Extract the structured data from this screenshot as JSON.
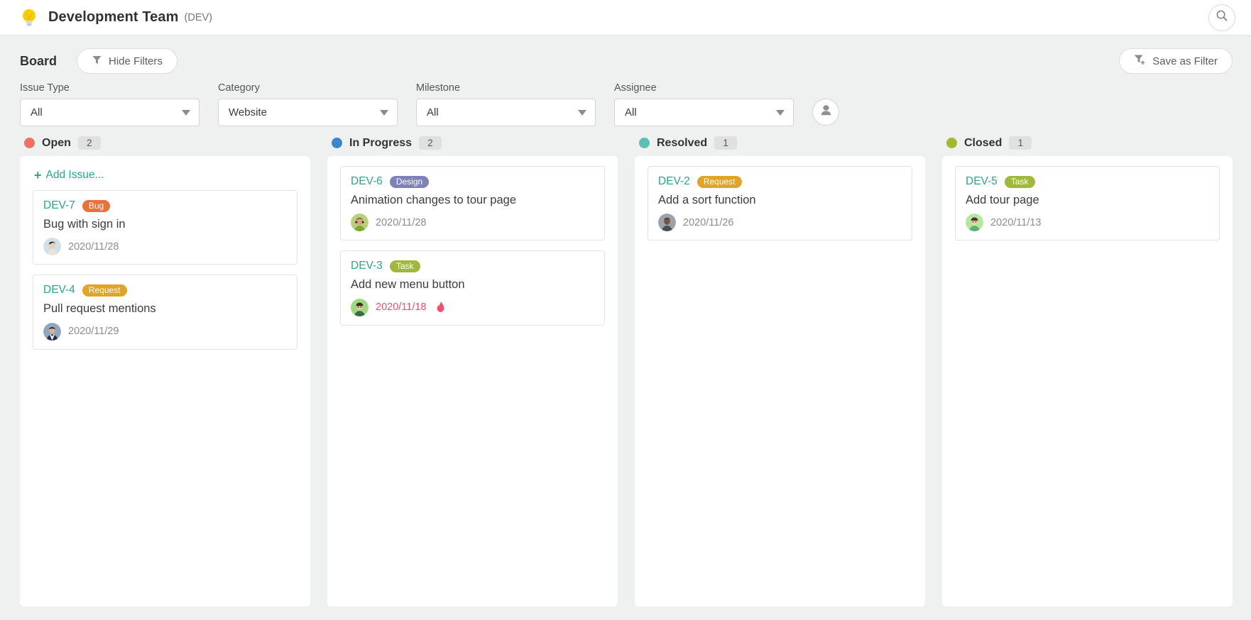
{
  "header": {
    "project_icon": "lightbulb-icon",
    "project_name": "Development Team",
    "project_key": "(DEV)",
    "search_icon": "search-icon"
  },
  "filters": {
    "board_label": "Board",
    "hide_filters_label": "Hide Filters",
    "hide_filters_icon": "funnel-icon",
    "save_as_filter_label": "Save as Filter",
    "save_as_filter_icon": "funnel-plus-icon",
    "assignee_quick_icon": "person-icon",
    "fields": [
      {
        "label": "Issue Type",
        "value": "All"
      },
      {
        "label": "Category",
        "value": "Website"
      },
      {
        "label": "Milestone",
        "value": "All"
      },
      {
        "label": "Assignee",
        "value": "All"
      }
    ]
  },
  "board": {
    "add_issue_label": "Add Issue...",
    "columns": [
      {
        "name": "Open",
        "count": "2",
        "color": "#ec7263",
        "show_add_issue": true,
        "cards": [
          {
            "key": "DEV-7",
            "badge": "Bug",
            "badge_color": "#ea7138",
            "title": "Bug with sign in",
            "date": "2020/11/28",
            "overdue": false,
            "avatar": "avatar-woman-dark-hair",
            "avatar_bg": "#cfe0e8",
            "avatar_fg": "#3a2b28"
          },
          {
            "key": "DEV-4",
            "badge": "Request",
            "badge_color": "#e0a526",
            "title": "Pull request mentions",
            "date": "2020/11/29",
            "overdue": false,
            "avatar": "avatar-man-suit",
            "avatar_bg": "#7d98b3",
            "avatar_fg": "#233247"
          }
        ]
      },
      {
        "name": "In Progress",
        "count": "2",
        "color": "#3b87cd",
        "show_add_issue": false,
        "cards": [
          {
            "key": "DEV-6",
            "badge": "Design",
            "badge_color": "#7e82b8",
            "title": "Animation changes to tour page",
            "date": "2020/11/28",
            "overdue": false,
            "avatar": "avatar-woman-curly",
            "avatar_bg": "#b9cf7c",
            "avatar_fg": "#4a3530"
          },
          {
            "key": "DEV-3",
            "badge": "Task",
            "badge_color": "#a0b93c",
            "title": "Add new menu button",
            "date": "2020/11/18",
            "overdue": true,
            "overdue_icon": "flame-icon",
            "avatar": "avatar-man-green",
            "avatar_bg": "#9fd97f",
            "avatar_fg": "#3c6b4a"
          }
        ]
      },
      {
        "name": "Resolved",
        "count": "1",
        "color": "#5bbfb1",
        "show_add_issue": false,
        "cards": [
          {
            "key": "DEV-2",
            "badge": "Request",
            "badge_color": "#e0a526",
            "title": "Add a sort function",
            "date": "2020/11/26",
            "overdue": false,
            "avatar": "avatar-man-bald",
            "avatar_bg": "#9aa3ab",
            "avatar_fg": "#3a2a22"
          }
        ]
      },
      {
        "name": "Closed",
        "count": "1",
        "color": "#a5b92e",
        "show_add_issue": false,
        "cards": [
          {
            "key": "DEV-5",
            "badge": "Task",
            "badge_color": "#a0b93c",
            "title": "Add tour page",
            "date": "2020/11/13",
            "overdue": false,
            "avatar": "avatar-man-green-light",
            "avatar_bg": "#b4e89a",
            "avatar_fg": "#4a3a2c"
          }
        ]
      }
    ]
  }
}
